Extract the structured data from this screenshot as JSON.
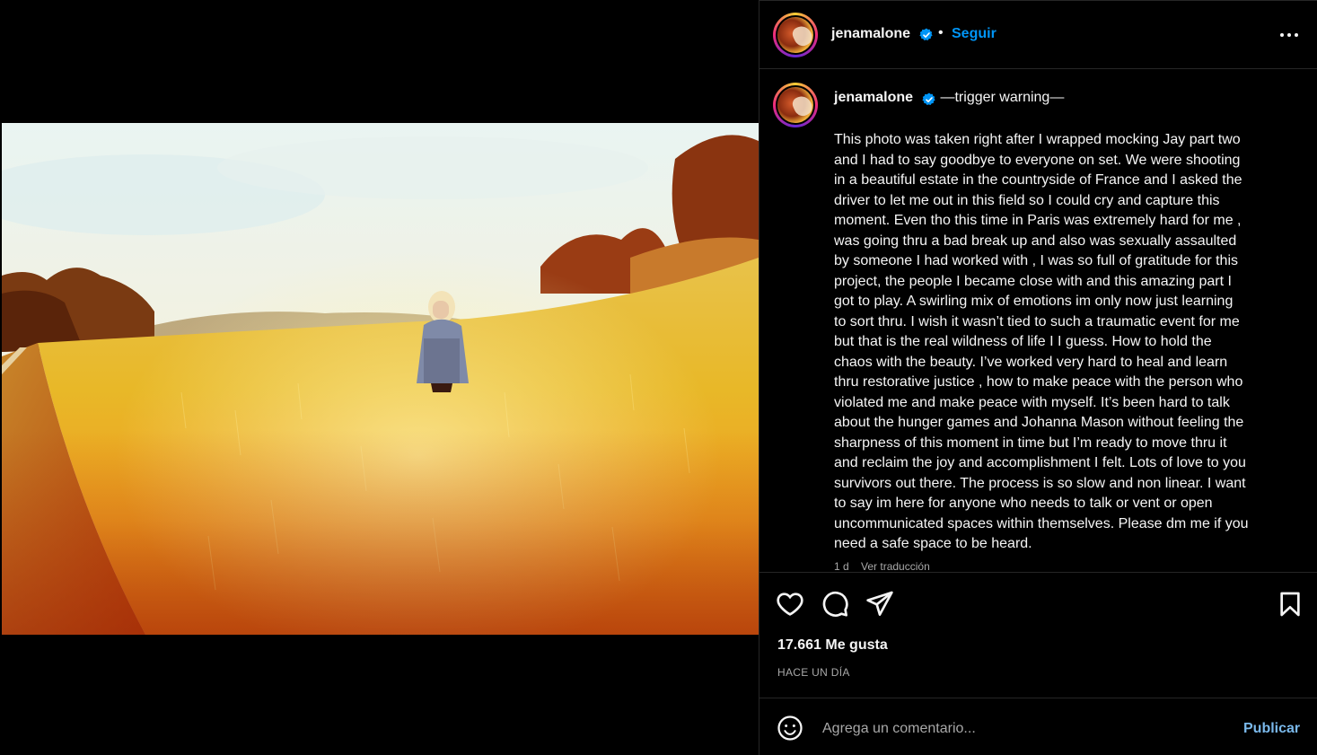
{
  "post": {
    "username": "jenamalone",
    "follow_label": "Seguir",
    "separator": "•"
  },
  "caption": {
    "username": "jenamalone",
    "headline": "—trigger warning—",
    "body": "This photo was taken right after I wrapped mocking Jay part two\nand I had to say goodbye to everyone on set. We were shooting\nin a beautiful estate in the countryside of France and I asked the\ndriver to let me out in this field so I could cry and capture this\nmoment. Even tho this time in Paris was extremely hard for me ,\nwas going thru a bad break up and also was sexually assaulted\nby someone I had worked with , I was so full of gratitude for this\nproject, the people I became close with and this amazing part I\ngot to play. A swirling mix of emotions im only now just learning\nto sort thru. I wish it wasn’t tied to such a traumatic event for me\nbut that is the real wildness of life I I guess. How to hold the\nchaos with the beauty. I’ve worked very hard to heal and learn\nthru restorative justice , how to make peace with the person who\nviolated me and make peace with myself. It’s been hard to talk\nabout the hunger games and Johanna Mason without feeling the\nsharpness of this moment in time but I’m ready to move thru it\nand reclaim the joy and accomplishment I felt. Lots of love to you\nsurvivors out there. The process is so slow and non linear. I want\nto say im here for anyone who needs to talk or vent or open\nuncommunicated spaces within themselves. Please dm me if you\nneed a safe space to be heard.",
    "age": "1 d",
    "translate_label": "Ver traducción"
  },
  "stats": {
    "likes": "17.661 Me gusta",
    "time_ago": "HACE UN DÍA"
  },
  "comment_box": {
    "placeholder": "Agrega un comentario...",
    "post_label": "Publicar"
  },
  "icons": {
    "like": "heart-icon",
    "comment": "comment-icon",
    "share": "share-icon",
    "save": "bookmark-icon",
    "more": "more-options-icon",
    "verified": "verified-badge-icon",
    "emoji": "emoji-icon"
  },
  "colors": {
    "accent": "#0095f6",
    "verified": "#0095f6",
    "publish": "#7ab8ea",
    "muted": "#a8a8a8",
    "border": "#262626"
  }
}
